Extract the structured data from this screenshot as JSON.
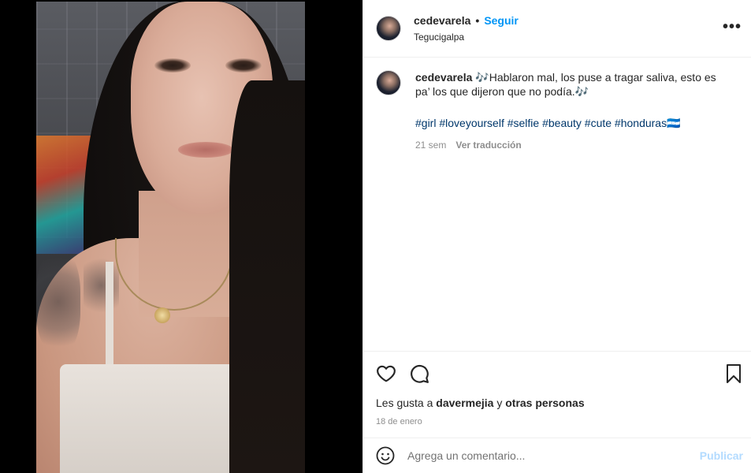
{
  "header": {
    "username": "cedevarela",
    "separator": "•",
    "follow_label": "Seguir",
    "location": "Tegucigalpa",
    "more_label": "•••"
  },
  "caption": {
    "username": "cedevarela",
    "text": "🎶Hablaron mal, los puse a tragar saliva, esto es pa’ los que dijeron que no podía.🎶",
    "hashtags": "#girl #loveyourself #selfie #beauty #cute #honduras🇭🇳",
    "time": "21 sem",
    "translate_label": "Ver traducción"
  },
  "likes": {
    "prefix": "Les gusta a",
    "user": "davermejia",
    "connector": "y",
    "others": "otras personas"
  },
  "date": "18 de enero",
  "comment": {
    "placeholder": "Agrega un comentario...",
    "publish_label": "Publicar"
  },
  "colors": {
    "accent": "#0095f6",
    "hashtag": "#00376b",
    "muted": "#8e8e8e",
    "publish_disabled": "#b3dbff"
  },
  "icons": [
    "heart-icon",
    "comment-icon",
    "bookmark-icon",
    "emoji-icon",
    "more-options-icon"
  ]
}
